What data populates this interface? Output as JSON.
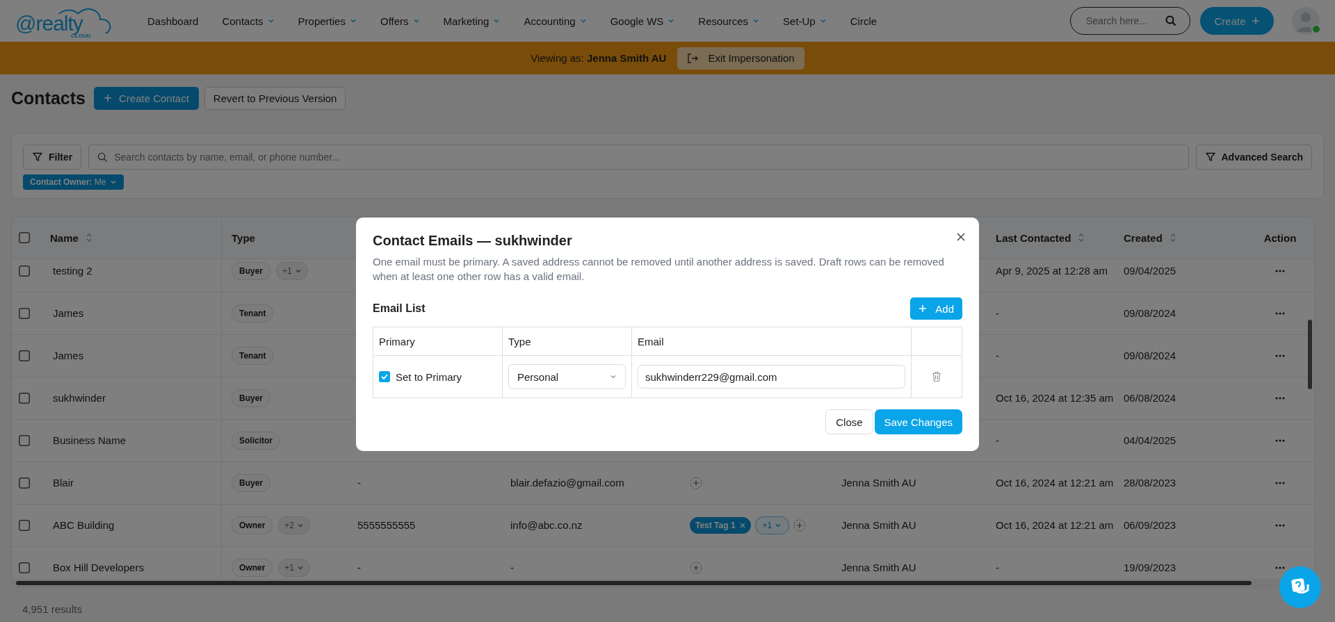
{
  "header": {
    "logo": {
      "text": "@realty",
      "sub": "CLOUD"
    },
    "nav": [
      {
        "label": "Dashboard",
        "has_menu": false
      },
      {
        "label": "Contacts",
        "has_menu": true
      },
      {
        "label": "Properties",
        "has_menu": true
      },
      {
        "label": "Offers",
        "has_menu": true
      },
      {
        "label": "Marketing",
        "has_menu": true
      },
      {
        "label": "Accounting",
        "has_menu": true
      },
      {
        "label": "Google WS",
        "has_menu": true
      },
      {
        "label": "Resources",
        "has_menu": true
      },
      {
        "label": "Set-Up",
        "has_menu": true
      },
      {
        "label": "Circle",
        "has_menu": false
      }
    ],
    "search": {
      "placeholder": "Search here..."
    },
    "create_button": "Create",
    "avatar": {
      "online": true
    }
  },
  "banner": {
    "text": "Viewing as: **Jenna Smith AU**",
    "exit_button": "Exit Impersonation"
  },
  "page": {
    "title": "Contacts",
    "buttons": [
      {
        "label": "Create Contact",
        "kind": "primary"
      },
      {
        "label": "Revert to Previous Version",
        "kind": "secondary"
      }
    ]
  },
  "filters": {
    "filter_button": "Filter",
    "search": {
      "placeholder": "Search contacts by name, email, or phone number..."
    },
    "advanced_button": "Advanced Search",
    "chips": [
      {
        "text": "**Contact Owner:** Me"
      }
    ]
  },
  "table": {
    "select_all": {
      "checked": false
    },
    "columns": [
      {
        "label": "Name",
        "sortable": true
      },
      {
        "label": "Type",
        "sortable": false
      },
      {
        "label": "Last Contacted",
        "sortable": true
      },
      {
        "label": "Created",
        "sortable": true
      },
      {
        "label": "Action",
        "sortable": false
      }
    ],
    "rows": [
      {
        "checked": false,
        "name": "testing 2",
        "types": [
          "Buyer"
        ],
        "more_types": "+1",
        "last_contacted": "Apr 9, 2025 at 12:28 am",
        "created": "09/04/2025"
      },
      {
        "checked": false,
        "name": "James",
        "types": [
          "Tenant"
        ],
        "last_contacted": "-",
        "created": "09/08/2024"
      },
      {
        "checked": false,
        "name": "James",
        "types": [
          "Tenant"
        ],
        "last_contacted": "-",
        "created": "09/08/2024"
      },
      {
        "checked": false,
        "name": "sukhwinder",
        "types": [
          "Buyer"
        ],
        "last_contacted": "Oct 16, 2024 at 12:35 am",
        "created": "06/08/2024"
      },
      {
        "checked": false,
        "name": "Business Name",
        "types": [
          "Solicitor"
        ],
        "last_contacted": "-",
        "created": "04/04/2025"
      },
      {
        "checked": false,
        "name": "Blair",
        "types": [
          "Buyer"
        ],
        "phone": "-",
        "email": "blair.defazio@gmail.com",
        "tags": [],
        "owner": "Jenna Smith AU",
        "last_contacted": "Oct 16, 2024 at 12:21 am",
        "created": "28/08/2023"
      },
      {
        "checked": false,
        "name": "ABC Building",
        "types": [
          "Owner"
        ],
        "more_types": "+2",
        "phone": "5555555555",
        "email": "info@abc.co.nz",
        "tags": [
          "Test Tag 1"
        ],
        "more_tags": "+1",
        "owner": "Jenna Smith AU",
        "last_contacted": "Oct 16, 2024 at 12:21 am",
        "created": "06/09/2023"
      },
      {
        "checked": false,
        "name": "Box Hill Developers",
        "types": [
          "Owner"
        ],
        "more_types": "+1",
        "phone": "-",
        "email": "-",
        "tags": [],
        "owner": "Jenna Smith AU",
        "last_contacted": "-",
        "created": "19/09/2023"
      }
    ]
  },
  "results": "4,951 results",
  "modal": {
    "title": "Contact Emails — sukhwinder",
    "description": "One email must be primary. A saved address cannot be removed until another address is saved. Draft rows can be removed when at least one other row has a valid email.",
    "list_title": "Email List",
    "add_button": "Add",
    "columns": [
      "Primary",
      "Type",
      "Email"
    ],
    "rows": [
      {
        "primary": true,
        "primary_label": "Set to Primary",
        "type": "Personal",
        "email": "sukhwinderr229@gmail.com"
      }
    ],
    "buttons": [
      {
        "label": "Close",
        "kind": "secondary"
      },
      {
        "label": "Save Changes",
        "kind": "primary"
      }
    ]
  }
}
